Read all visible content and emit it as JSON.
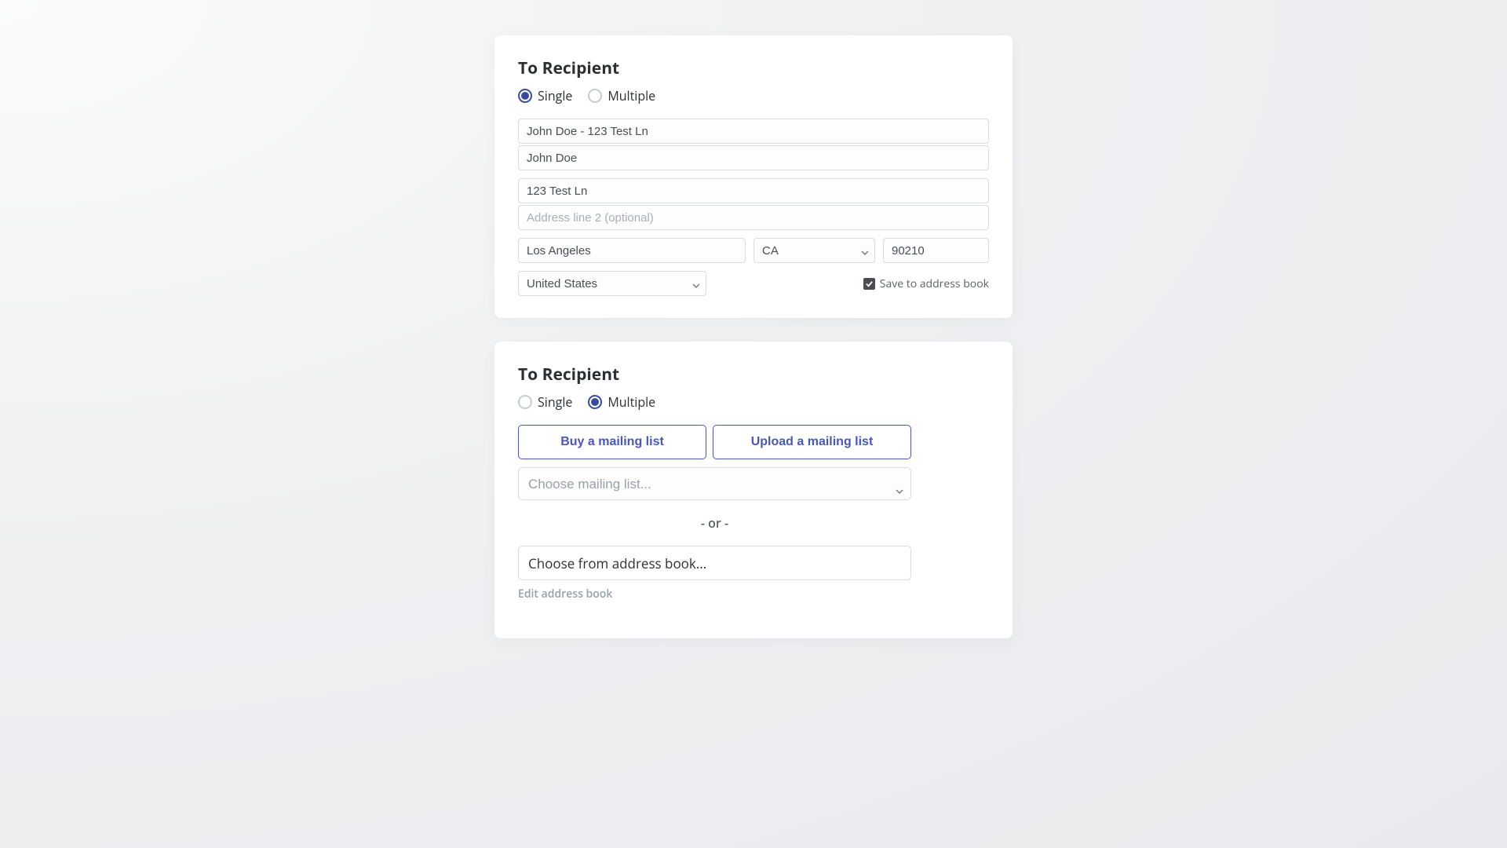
{
  "colors": {
    "accent": "#3a4a9f",
    "button_accent": "#4a56c0",
    "text_primary": "#2d2f33",
    "text_muted": "#9ba0a8"
  },
  "card1": {
    "title": "To Recipient",
    "radio_single": "Single",
    "radio_multiple": "Multiple",
    "address_search": "John Doe - 123 Test Ln",
    "name": "John Doe",
    "address1": "123 Test Ln",
    "address2_placeholder": "Address line 2 (optional)",
    "city": "Los Angeles",
    "state": "CA",
    "zip": "90210",
    "country": "United States",
    "save_checkbox_label": "Save to address book",
    "save_checked": true
  },
  "card2": {
    "title": "To Recipient",
    "radio_single": "Single",
    "radio_multiple": "Multiple",
    "buy_button": "Buy a mailing list",
    "upload_button": "Upload a mailing list",
    "mailing_list_placeholder": "Choose mailing list...",
    "or_text": "- or -",
    "address_book_placeholder": "Choose from address book...",
    "edit_link": "Edit address book"
  }
}
